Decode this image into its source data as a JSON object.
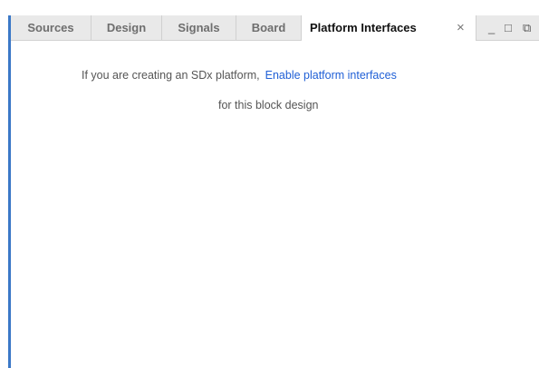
{
  "tabs": [
    {
      "label": "Sources"
    },
    {
      "label": "Design"
    },
    {
      "label": "Signals"
    },
    {
      "label": "Board"
    },
    {
      "label": "Platform Interfaces"
    }
  ],
  "active_tab": "Platform Interfaces",
  "controls": {
    "close": "×",
    "minimize": "_",
    "maximize": "□",
    "float": "⧉"
  },
  "content": {
    "message_prefix": "If you are creating an SDx platform,",
    "link_text": "Enable platform interfaces",
    "message_suffix": "for this block design"
  },
  "colors": {
    "accent_border": "#3b78c7",
    "link": "#1f5fd6"
  }
}
